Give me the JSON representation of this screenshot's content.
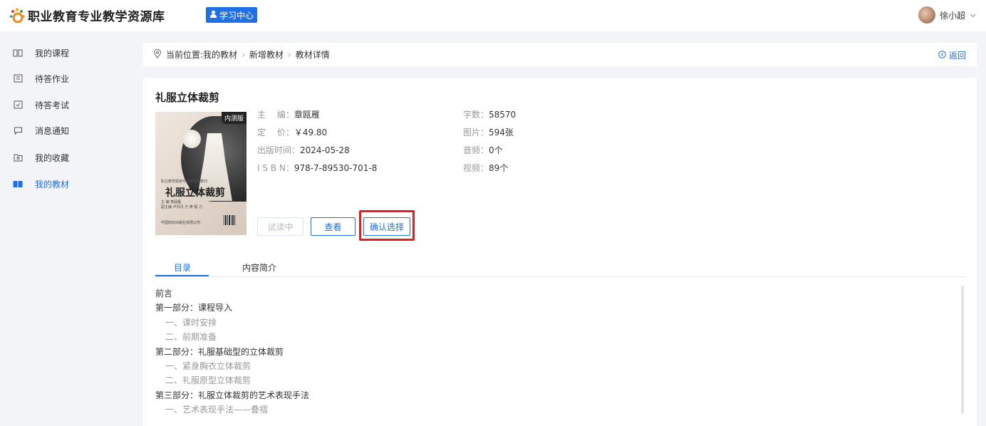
{
  "header": {
    "site_title": "职业教育专业教学资源库",
    "study_center": "学习中心",
    "user_name": "徐小超"
  },
  "sidebar": {
    "items": [
      {
        "label": "我的课程",
        "icon": "book-open-icon"
      },
      {
        "label": "待答作业",
        "icon": "homework-icon"
      },
      {
        "label": "待答考试",
        "icon": "exam-icon"
      },
      {
        "label": "消息通知",
        "icon": "message-icon"
      },
      {
        "label": "我的收藏",
        "icon": "folder-star-icon"
      },
      {
        "label": "我的教材",
        "icon": "textbook-icon",
        "active": true
      }
    ]
  },
  "breadcrumb": {
    "prefix": "当前位置: ",
    "items": [
      "我的教材",
      "新增教材",
      "教材详情"
    ],
    "back": "返回"
  },
  "book": {
    "title": "礼服立体裁剪",
    "cover": {
      "ribbon": "内测版",
      "series": "职业教育服装专业新形态教材",
      "title": "礼服立体裁剪",
      "authors": "主 编 章瓯雁",
      "co_authors": "副主编 卢丹丹 方 英 程 力",
      "publisher": "中国纺织出版社有限公司"
    },
    "left_meta": [
      {
        "label": "主　 编：",
        "value": "章瓯雁"
      },
      {
        "label": "定　 价：",
        "value": "￥49.80"
      },
      {
        "label": "出版时间：",
        "value": "2024-05-28"
      },
      {
        "label": "I S B N：",
        "value": "978-7-89530-701-8"
      }
    ],
    "right_meta": [
      {
        "label": "字数：",
        "value": "58570"
      },
      {
        "label": "图片：",
        "value": "594张"
      },
      {
        "label": "音频：",
        "value": "0个"
      },
      {
        "label": "视频：",
        "value": "89个"
      }
    ],
    "buttons": {
      "trial": "试读中",
      "view": "查看",
      "confirm": "确认选择"
    }
  },
  "tabs": [
    "目录",
    "内容简介"
  ],
  "toc": [
    {
      "level": 1,
      "text": "前言"
    },
    {
      "level": 1,
      "text": "第一部分：课程导入"
    },
    {
      "level": 2,
      "text": "一、课时安排"
    },
    {
      "level": 2,
      "text": "二、前期准备"
    },
    {
      "level": 1,
      "text": "第二部分：礼服基础型的立体裁剪"
    },
    {
      "level": 2,
      "text": "一、紧身胸衣立体裁剪"
    },
    {
      "level": 2,
      "text": "二、礼服原型立体裁剪"
    },
    {
      "level": 1,
      "text": "第三部分：礼服立体裁剪的艺术表现手法"
    },
    {
      "level": 2,
      "text": "一、艺术表现手法——叠褶"
    }
  ],
  "colors": {
    "accent": "#1f6fe5",
    "highlight": "#e02020"
  }
}
